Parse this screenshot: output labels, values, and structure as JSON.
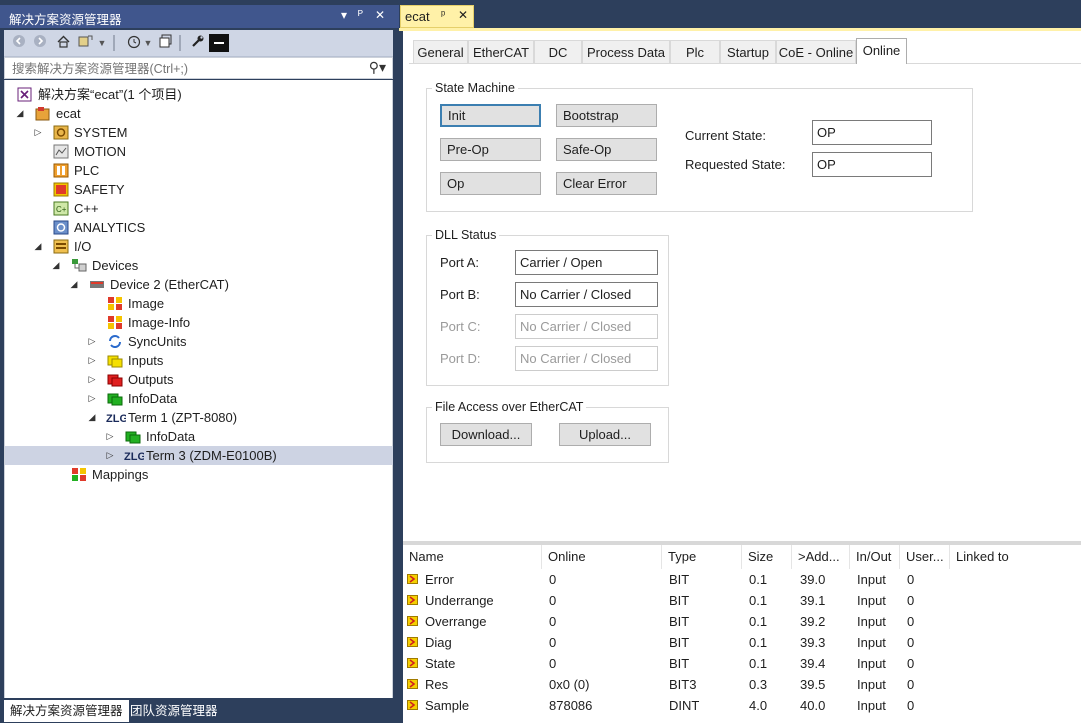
{
  "left_panel": {
    "title": "解决方案资源管理器",
    "title_controls": [
      "▾",
      "ᴾ",
      "✕"
    ],
    "search_placeholder": "搜索解决方案资源管理器(Ctrl+;)",
    "tree": [
      {
        "label": "解决方案“ecat”(1 个项目)",
        "icon": "solution-icon"
      },
      {
        "label": "ecat",
        "icon": "project-icon"
      },
      {
        "label": "SYSTEM",
        "icon": "system-icon"
      },
      {
        "label": "MOTION",
        "icon": "motion-icon"
      },
      {
        "label": "PLC",
        "icon": "plc-icon"
      },
      {
        "label": "SAFETY",
        "icon": "safety-icon"
      },
      {
        "label": "C++",
        "icon": "cpp-icon"
      },
      {
        "label": "ANALYTICS",
        "icon": "analytics-icon"
      },
      {
        "label": "I/O",
        "icon": "io-icon"
      },
      {
        "label": "Devices",
        "icon": "devices-icon"
      },
      {
        "label": "Device 2 (EtherCAT)",
        "icon": "ethercat-device-icon"
      },
      {
        "label": "Image",
        "icon": "image-icon"
      },
      {
        "label": "Image-Info",
        "icon": "image-info-icon"
      },
      {
        "label": "SyncUnits",
        "icon": "syncunits-icon"
      },
      {
        "label": "Inputs",
        "icon": "inputs-icon"
      },
      {
        "label": "Outputs",
        "icon": "outputs-icon"
      },
      {
        "label": "InfoData",
        "icon": "infodata-icon"
      },
      {
        "label": "Term 1 (ZPT-8080)",
        "icon": "zlg-term-icon"
      },
      {
        "label": "InfoData",
        "icon": "infodata-icon"
      },
      {
        "label": "Term 3 (ZDM-E0100B)",
        "icon": "zlg-term-icon"
      },
      {
        "label": "Mappings",
        "icon": "mappings-icon"
      }
    ],
    "bottom_tabs": [
      "解决方案资源管理器",
      "团队资源管理器"
    ]
  },
  "document_tab": {
    "title": "ecat",
    "pin": "ᵖ",
    "close": "✕"
  },
  "property_tabs": [
    "General",
    "EtherCAT",
    "DC",
    "Process Data",
    "Plc",
    "Startup",
    "CoE - Online",
    "Online"
  ],
  "state_machine": {
    "title": "State Machine",
    "buttons": [
      "Init",
      "Bootstrap",
      "Pre-Op",
      "Safe-Op",
      "Op",
      "Clear Error"
    ],
    "current_state_label": "Current State:",
    "current_state_value": "OP",
    "requested_state_label": "Requested State:",
    "requested_state_value": "OP"
  },
  "dll_status": {
    "title": "DLL Status",
    "ports": [
      {
        "label": "Port A:",
        "value": "Carrier / Open",
        "enabled": true
      },
      {
        "label": "Port B:",
        "value": "No Carrier / Closed",
        "enabled": true
      },
      {
        "label": "Port C:",
        "value": "No Carrier / Closed",
        "enabled": false
      },
      {
        "label": "Port D:",
        "value": "No Carrier / Closed",
        "enabled": false
      }
    ]
  },
  "file_access": {
    "title": "File Access over EtherCAT",
    "download": "Download...",
    "upload": "Upload..."
  },
  "grid": {
    "columns": [
      "Name",
      "Online",
      "Type",
      "Size",
      ">Add...",
      "In/Out",
      "User...",
      "Linked to"
    ],
    "rows": [
      [
        "Error",
        "0",
        "BIT",
        "0.1",
        "39.0",
        "Input",
        "0",
        ""
      ],
      [
        "Underrange",
        "0",
        "BIT",
        "0.1",
        "39.1",
        "Input",
        "0",
        ""
      ],
      [
        "Overrange",
        "0",
        "BIT",
        "0.1",
        "39.2",
        "Input",
        "0",
        ""
      ],
      [
        "Diag",
        "0",
        "BIT",
        "0.1",
        "39.3",
        "Input",
        "0",
        ""
      ],
      [
        "State",
        "0",
        "BIT",
        "0.1",
        "39.4",
        "Input",
        "0",
        ""
      ],
      [
        "Res",
        "0x0 (0)",
        "BIT3",
        "0.3",
        "39.5",
        "Input",
        "0",
        ""
      ],
      [
        "Sample",
        "878086",
        "DINT",
        "4.0",
        "40.0",
        "Input",
        "0",
        ""
      ]
    ]
  },
  "colors": {
    "title_bar": "#40568d",
    "background": "#2d3f5c",
    "doc_tab": "#fff1a8",
    "selection": "#cdd3e3",
    "focus_border": "#3c7fb1"
  }
}
